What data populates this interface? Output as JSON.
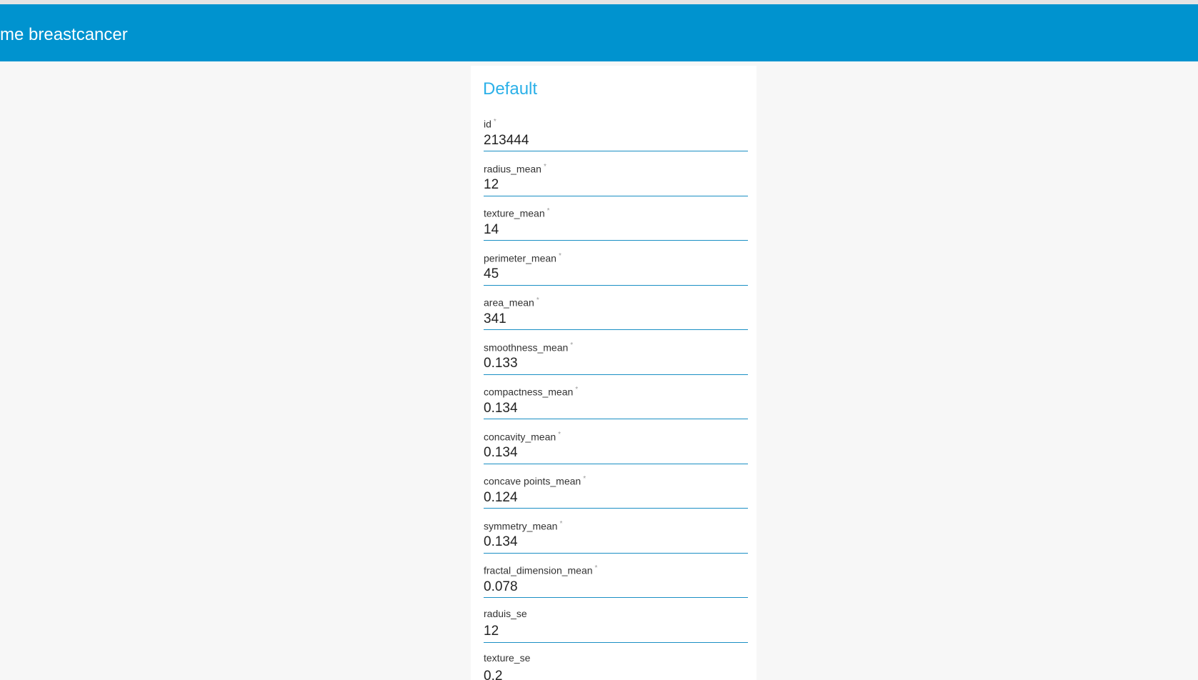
{
  "app": {
    "title": "me breastcancer"
  },
  "colors": {
    "appbar": "#0093cf",
    "section_title": "#2bb0e8",
    "underline": "#1a8fc4"
  },
  "form": {
    "section_title": "Default",
    "required_marker": "*",
    "fields": [
      {
        "label": "id",
        "value": "213444",
        "required": true
      },
      {
        "label": "radius_mean",
        "value": "12",
        "required": true
      },
      {
        "label": "texture_mean",
        "value": "14",
        "required": true
      },
      {
        "label": "perimeter_mean",
        "value": "45",
        "required": true
      },
      {
        "label": "area_mean",
        "value": "341",
        "required": true
      },
      {
        "label": "smoothness_mean",
        "value": "0.133",
        "required": true
      },
      {
        "label": "compactness_mean",
        "value": "0.134",
        "required": true
      },
      {
        "label": "concavity_mean",
        "value": "0.134",
        "required": true
      },
      {
        "label": "concave points_mean",
        "value": "0.124",
        "required": true
      },
      {
        "label": "symmetry_mean",
        "value": "0.134",
        "required": true
      },
      {
        "label": "fractal_dimension_mean",
        "value": "0.078",
        "required": true
      },
      {
        "label": "raduis_se",
        "value": "12",
        "required": false
      },
      {
        "label": "texture_se",
        "value": "0.2",
        "required": false
      }
    ]
  }
}
